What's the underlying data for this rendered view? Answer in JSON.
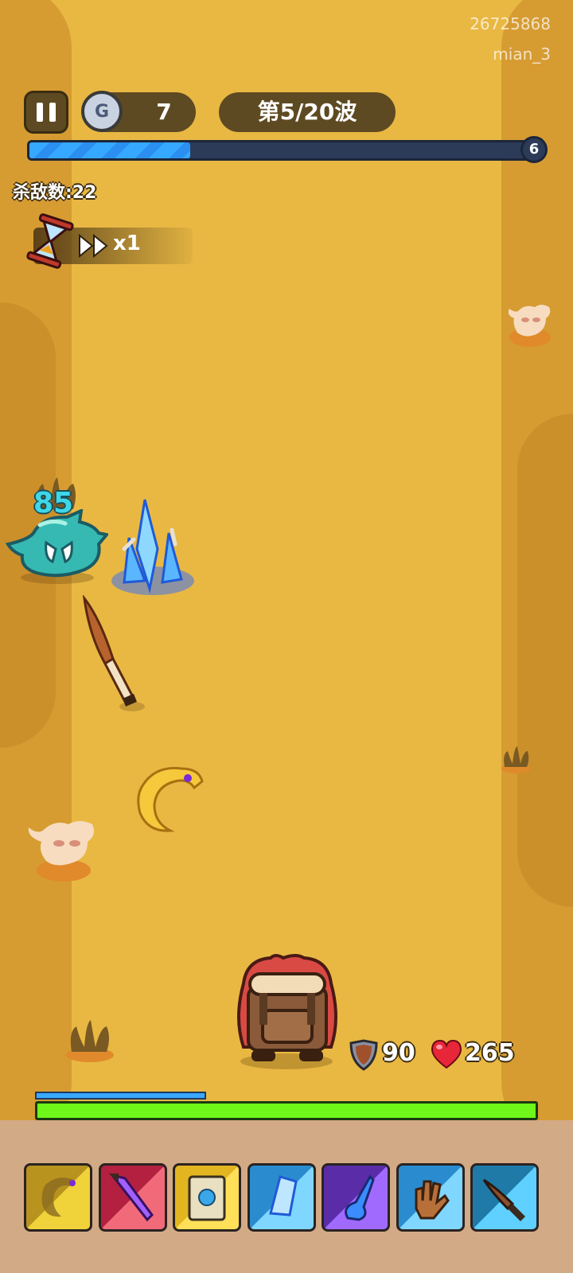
{
  "watermark": {
    "id": "26725868",
    "user": "mian_3"
  },
  "hud": {
    "coins": "7",
    "wave": "第5/20波",
    "wave_progress": 0.32,
    "level": "6",
    "kills": "杀敌数:22",
    "speed": "x1"
  },
  "combat": {
    "damage_number": "85"
  },
  "player": {
    "shield": "90",
    "hp": "265",
    "mana_fraction": 0.34,
    "hp_fraction": 1.0
  },
  "skills": [
    {
      "name": "golden-horn",
      "colors": [
        "#b8941e",
        "#f0d23a"
      ]
    },
    {
      "name": "purple-dagger",
      "colors": [
        "#b32040",
        "#f06a7a"
      ]
    },
    {
      "name": "spell-book",
      "colors": [
        "#e3b520",
        "#ffe058"
      ]
    },
    {
      "name": "ice-crystal",
      "colors": [
        "#2a8ccf",
        "#7fd6ff"
      ]
    },
    {
      "name": "blue-claw",
      "colors": [
        "#5a2ca8",
        "#a06aff"
      ]
    },
    {
      "name": "leather-glove",
      "colors": [
        "#2a8ccf",
        "#7fd6ff"
      ]
    },
    {
      "name": "stone-knife",
      "colors": [
        "#1f7aa8",
        "#5fd0ff"
      ]
    }
  ],
  "colors": {
    "sand": "#e9b843",
    "wall": "#d69c32",
    "panel": "#d3aa86",
    "hp_green": "#6ff71a",
    "progress_blue": "#36a8ff"
  }
}
